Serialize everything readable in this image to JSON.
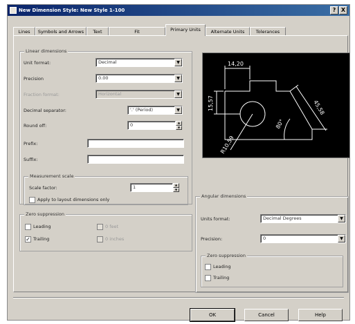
{
  "window": {
    "title": "New Dimension Style: New Style 1-100",
    "help_label": "?",
    "close_label": "X"
  },
  "tabs": [
    {
      "label": "Lines"
    },
    {
      "label": "Symbols and Arrows"
    },
    {
      "label": "Text"
    },
    {
      "label": "Fit"
    },
    {
      "label": "Primary Units"
    },
    {
      "label": "Alternate Units"
    },
    {
      "label": "Tolerances"
    }
  ],
  "linear": {
    "group_label": "Linear dimensions",
    "unit_format_label": "Unit format:",
    "unit_format_value": "Decimal",
    "precision_label": "Precision",
    "precision_value": "0.00",
    "fraction_format_label": "Fraction format:",
    "fraction_format_value": "Horizontal",
    "decimal_separator_label": "Decimal separator:",
    "decimal_separator_value": "'.' (Period)",
    "round_off_label": "Round off:",
    "round_off_value": "0",
    "prefix_label": "Prefix:",
    "prefix_value": "",
    "suffix_label": "Suffix:",
    "suffix_value": ""
  },
  "measurement_scale": {
    "group_label": "Measurement scale",
    "scale_factor_label": "Scale factor:",
    "scale_factor_value": "1",
    "apply_layout_label": "Apply to layout dimensions only"
  },
  "zero_suppression_linear": {
    "group_label": "Zero suppression",
    "leading_label": "Leading",
    "trailing_label": "Trailing",
    "feet_label": "0 feet",
    "inches_label": "0 inches"
  },
  "angular": {
    "group_label": "Angular dimensions",
    "units_format_label": "Units format:",
    "units_format_value": "Decimal Degrees",
    "precision_label": "Precision:",
    "precision_value": "0",
    "zero_group_label": "Zero suppression",
    "leading_label": "Leading",
    "trailing_label": "Trailing"
  },
  "preview": {
    "dim_top": "14,20",
    "dim_left": "15,57",
    "dim_right": "45,58",
    "dim_angle": "80°",
    "dim_radius": "R10,59"
  },
  "buttons": {
    "ok": "OK",
    "cancel": "Cancel",
    "help": "Help"
  },
  "colors": {
    "title_bar": "#0a246a",
    "dialog_face": "#d4d0c8",
    "preview_bg": "#000000",
    "preview_lines": "#ffffff"
  }
}
